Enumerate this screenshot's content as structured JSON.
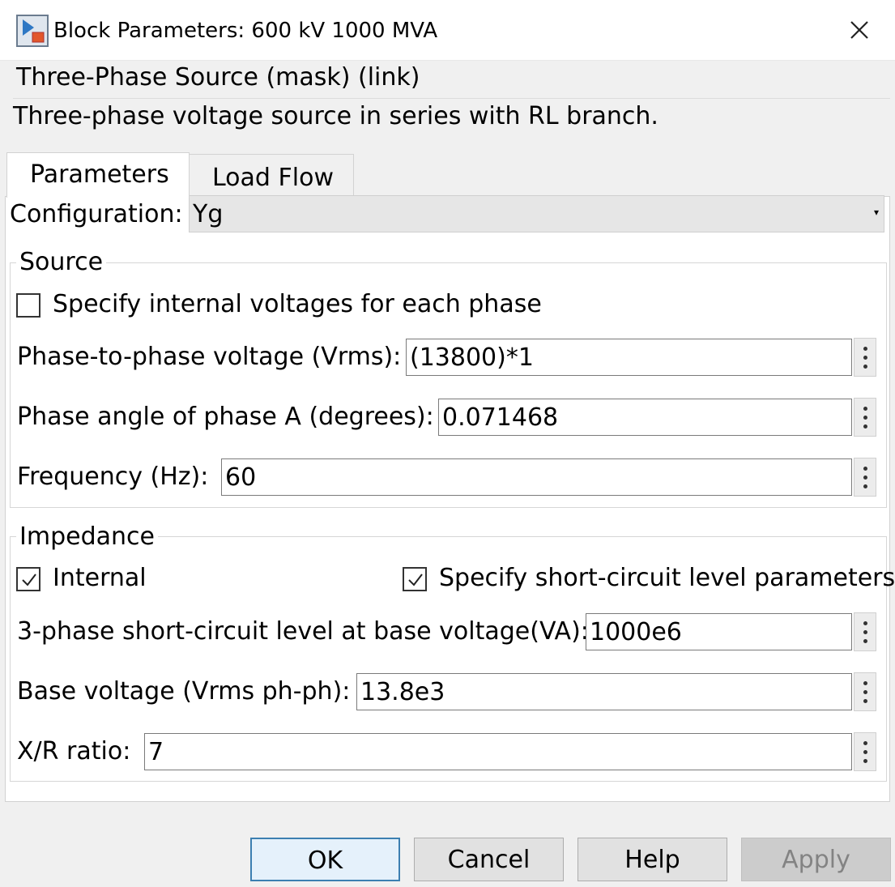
{
  "window": {
    "title": "Block Parameters: 600 kV 1000 MVA",
    "close_icon": "close-icon"
  },
  "mask": {
    "title": "Three-Phase Source (mask) (link)",
    "description": "Three-phase voltage source in series with RL branch."
  },
  "tabs": [
    {
      "label": "Parameters",
      "active": true
    },
    {
      "label": "Load Flow",
      "active": false
    }
  ],
  "configuration": {
    "label": "Configuration:",
    "value": "Yg"
  },
  "source": {
    "legend": "Source",
    "internal_voltages": {
      "label": "Specify internal voltages for each phase",
      "checked": false
    },
    "phase_voltage": {
      "label": "Phase-to-phase voltage (Vrms):",
      "value": "(13800)*1"
    },
    "phase_angle": {
      "label": "Phase angle of phase A (degrees):",
      "value": "0.071468"
    },
    "frequency": {
      "label": "Frequency (Hz):",
      "value": "60"
    }
  },
  "impedance": {
    "legend": "Impedance",
    "internal": {
      "label": "Internal",
      "checked": true
    },
    "short_circuit_params": {
      "label": "Specify short-circuit level parameters",
      "checked": true
    },
    "sc_level": {
      "label": "3-phase short-circuit level at base voltage(VA):",
      "value": "1000e6"
    },
    "base_voltage": {
      "label": "Base voltage (Vrms ph-ph):",
      "value": "13.8e3"
    },
    "xr_ratio": {
      "label": "X/R ratio:",
      "value": "7"
    }
  },
  "buttons": {
    "ok": "OK",
    "cancel": "Cancel",
    "help": "Help",
    "apply": "Apply"
  }
}
